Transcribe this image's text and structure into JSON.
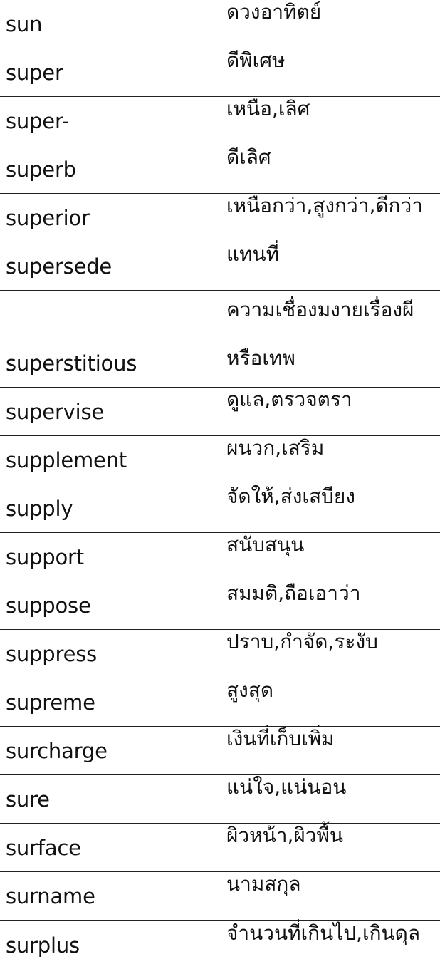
{
  "rows": [
    {
      "word": "sun",
      "meaning": "ดวงอาทิตย์"
    },
    {
      "word": "super",
      "meaning": "ดีพิเศษ"
    },
    {
      "word": "super-",
      "meaning": "เหนือ,เลิศ"
    },
    {
      "word": "superb",
      "meaning": "ดีเลิศ"
    },
    {
      "word": "superior",
      "meaning": "เหนือกว่า,สูงกว่า,ดีกว่า"
    },
    {
      "word": "supersede",
      "meaning": "แทนที่"
    },
    {
      "word": "superstitious",
      "meaning_line1": "ความเชื่องมงายเรื่องผี",
      "meaning_line2": "หรือเทพ"
    },
    {
      "word": "supervise",
      "meaning": "ดูแล,ตรวจตรา"
    },
    {
      "word": "supplement",
      "meaning": "ผนวก,เสริม"
    },
    {
      "word": "supply",
      "meaning": "จัดให้,ส่งเสบียง"
    },
    {
      "word": "support",
      "meaning": "สนับสนุน"
    },
    {
      "word": "suppose",
      "meaning": "สมมติ,ถือเอาว่า"
    },
    {
      "word": "suppress",
      "meaning": "ปราบ,กำจัด,ระงับ"
    },
    {
      "word": "supreme",
      "meaning": "สูงสุด"
    },
    {
      "word": "surcharge",
      "meaning": "เงินที่เก็บเพิ่ม"
    },
    {
      "word": "sure",
      "meaning": "แน่ใจ,แน่นอน"
    },
    {
      "word": "surface",
      "meaning": "ผิวหน้า,ผิวพื้น"
    },
    {
      "word": "surname",
      "meaning": "นามสกุล"
    },
    {
      "word": "surplus",
      "meaning": "จำนวนที่เกินไป,เกินดุล"
    }
  ]
}
